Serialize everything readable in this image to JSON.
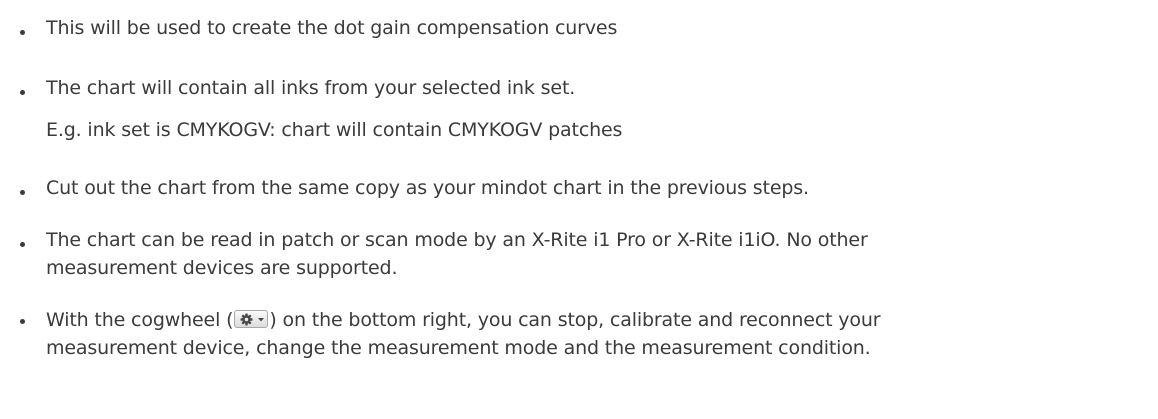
{
  "bullets": [
    {
      "lines": [
        "This will be used to create the dot gain compensation curves"
      ]
    },
    {
      "lines": [
        "The chart will contain all inks from your selected ink set.",
        "E.g. ink set is CMYKOGV: chart will contain CMYKOGV patches"
      ]
    },
    {
      "lines": [
        "Cut out the chart from the same copy as your mindot chart in the previous steps."
      ]
    },
    {
      "lines": [
        "The chart can be read in patch or scan mode by an X-Rite i1 Pro or X-Rite i1iO. No other",
        "measurement devices are supported."
      ]
    },
    {
      "line1_before_icon": "With the cogwheel (",
      "line1_after_icon": ") on the bottom right, you can stop, calibrate and reconnect your",
      "line2": "measurement device, change the measurement mode and the measurement condition.",
      "icon": "gear-dropdown-icon"
    }
  ]
}
